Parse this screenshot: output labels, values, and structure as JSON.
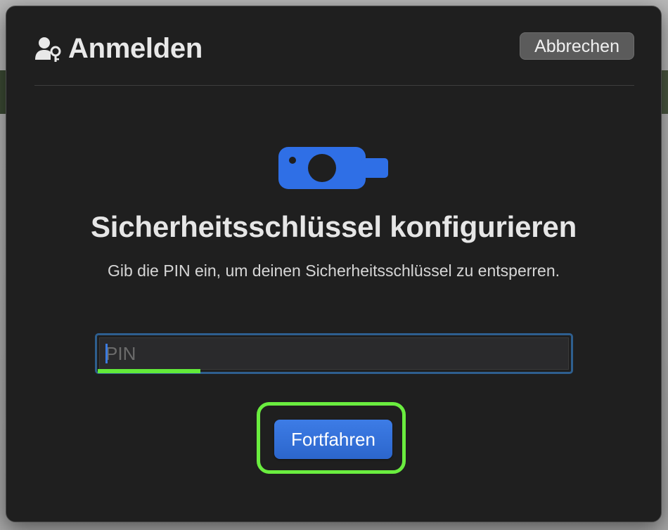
{
  "dialog": {
    "title": "Anmelden",
    "cancel_label": "Abbrechen",
    "heading": "Sicherheitsschlüssel konfigurieren",
    "description": "Gib die PIN ein, um deinen Sicherheitsschlüssel zu entsperren.",
    "pin": {
      "placeholder": "PIN",
      "value": ""
    },
    "continue_label": "Fortfahren"
  },
  "icons": {
    "title_icon": "user-key-icon",
    "hero_icon": "security-key-icon"
  },
  "colors": {
    "accent": "#2f6fd8",
    "focus_highlight": "#62ea3a",
    "dialog_bg": "#1f1f1f"
  }
}
